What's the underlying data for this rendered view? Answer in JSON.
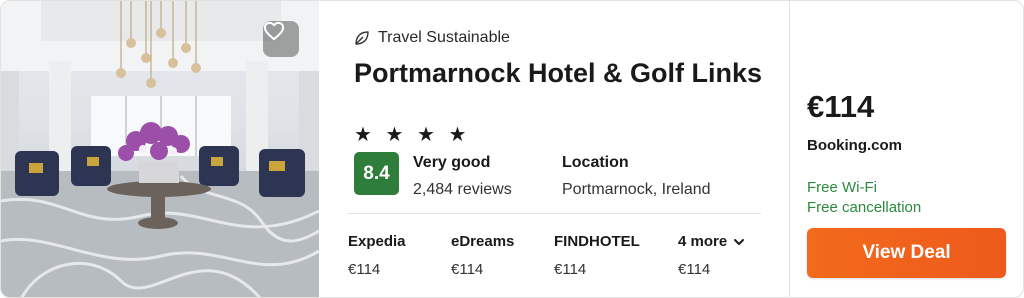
{
  "hotel": {
    "sustainability_label": "Travel Sustainable",
    "sustainability_icon": "leaf-icon",
    "name": "Portmarnock Hotel & Golf Links",
    "stars": "★ ★ ★ ★",
    "star_count": 4,
    "rating_score": "8.4",
    "rating_label": "Very good",
    "review_count": "2,484 reviews",
    "location_label": "Location",
    "location_value": "Portmarnock, Ireland",
    "favorite_icon": "heart-outline-icon"
  },
  "providers": [
    {
      "name": "Expedia",
      "price": "€114"
    },
    {
      "name": "eDreams",
      "price": "€114"
    },
    {
      "name": "FINDHOTEL",
      "price": "€114"
    },
    {
      "name": "4 more",
      "price": "€114",
      "icon": "chevron-down-icon"
    }
  ],
  "deal": {
    "price": "€114",
    "seller": "Booking.com",
    "perks": [
      "Free Wi-Fi",
      "Free cancellation"
    ],
    "button_label": "View Deal"
  },
  "colors": {
    "rating_bg": "#2e7d3a",
    "perk_green": "#2b8a3e",
    "button_orange": "#f26a1b"
  }
}
